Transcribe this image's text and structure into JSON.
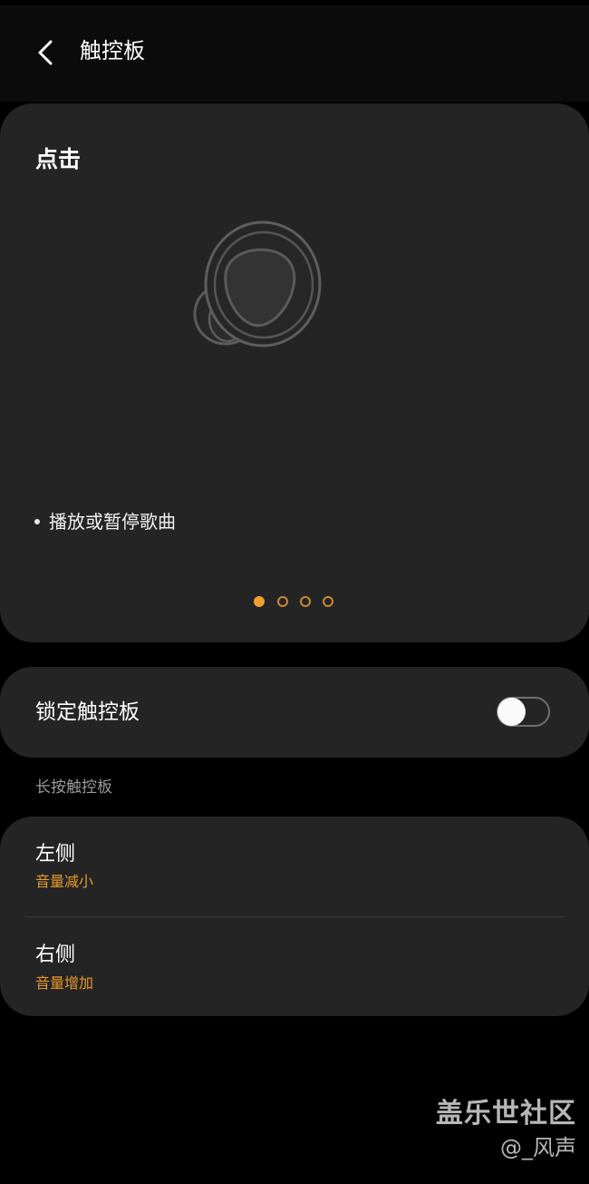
{
  "header": {
    "title": "触控板",
    "back_icon": "chevron-left-icon"
  },
  "tap_card": {
    "title": "点击",
    "description": "播放或暂停歌曲",
    "illustration": "earbud-icon",
    "pager": {
      "total": 4,
      "active_index": 0,
      "active_color": "#f0a030"
    }
  },
  "lock": {
    "label": "锁定触控板",
    "enabled": false
  },
  "long_press": {
    "section_label": "长按触控板",
    "rows": [
      {
        "title": "左侧",
        "value": "音量减小"
      },
      {
        "title": "右侧",
        "value": "音量增加"
      }
    ]
  },
  "watermark": {
    "main": "盖乐世社区",
    "sub": "@_风声"
  },
  "colors": {
    "accent": "#e8992a",
    "card_bg": "#242424",
    "background": "#000000"
  }
}
